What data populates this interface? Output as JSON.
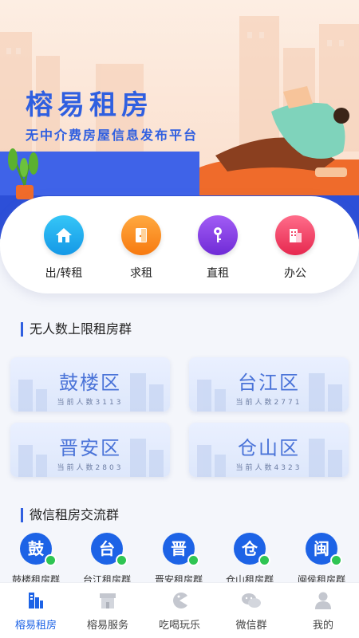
{
  "hero": {
    "title": "榕易租房",
    "subtitle": "无中介费房屋信息发布平台"
  },
  "quick_actions": [
    {
      "label": "出/转租",
      "icon": "house-icon",
      "color": "#1fb3f0"
    },
    {
      "label": "求租",
      "icon": "door-icon",
      "color": "#ff8f1f"
    },
    {
      "label": "直租",
      "icon": "key-icon",
      "color": "#8a3df0"
    },
    {
      "label": "办公",
      "icon": "building-icon",
      "color": "#f2466a"
    }
  ],
  "districts_section": {
    "title": "无人数上限租房群",
    "items": [
      {
        "name": "鼓楼区",
        "count": "当前人数3113"
      },
      {
        "name": "台江区",
        "count": "当前人数2771"
      },
      {
        "name": "晋安区",
        "count": "当前人数2803"
      },
      {
        "name": "仓山区",
        "count": "当前人数4323"
      }
    ]
  },
  "wechat_section": {
    "title": "微信租房交流群",
    "items": [
      {
        "char": "鼓",
        "label": "鼓楼租房群"
      },
      {
        "char": "台",
        "label": "台江租房群"
      },
      {
        "char": "晋",
        "label": "晋安租房群"
      },
      {
        "char": "仓",
        "label": "仓山租房群"
      },
      {
        "char": "闽",
        "label": "闽侯租房群"
      }
    ]
  },
  "tabbar": {
    "active_color": "#1d63e6",
    "items": [
      {
        "label": "榕易租房",
        "icon": "buildings-icon",
        "active": true
      },
      {
        "label": "榕易服务",
        "icon": "store-icon",
        "active": false
      },
      {
        "label": "吃喝玩乐",
        "icon": "pacman-icon",
        "active": false
      },
      {
        "label": "微信群",
        "icon": "wechat-icon",
        "active": false
      },
      {
        "label": "我的",
        "icon": "user-icon",
        "active": false
      }
    ]
  }
}
